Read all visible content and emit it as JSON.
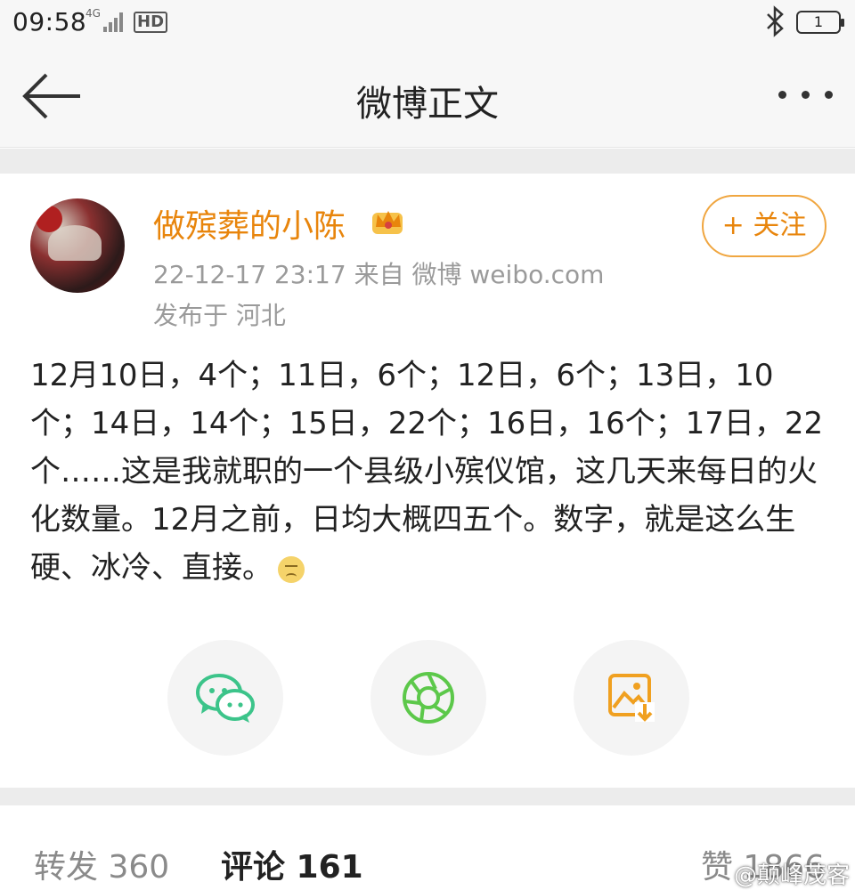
{
  "status_bar": {
    "time": "09:58",
    "network": "4G",
    "hd_label": "HD",
    "battery": "1"
  },
  "nav": {
    "title": "微博正文",
    "back_icon": "arrow-left-icon",
    "more_icon": "more-dots-icon"
  },
  "post": {
    "username": "做殡葬的小陈",
    "badge_icon": "crown-icon",
    "meta": "22-12-17 23:17  来自 微博 weibo.com",
    "location": "发布于 河北",
    "follow_label": "+ 关注",
    "text": "12月10日，4个；11日，6个；12日，6个；13日，10个；14日，14个；15日，22个；16日，16个；17日，22个……这是我就职的一个县级小殡仪馆，这几天来每日的火化数量。12月之前，日均大概四五个。数字，就是这么生硬、冰冷、直接。",
    "emoji_icon": "sad-face-icon"
  },
  "share": {
    "items": [
      {
        "icon": "wechat-icon"
      },
      {
        "icon": "moments-icon"
      },
      {
        "icon": "save-image-icon"
      }
    ]
  },
  "tabs": {
    "repost": "转发 360",
    "comments": "评论 161",
    "likes": "赞 1866"
  },
  "watermark": "@颠峰茂客",
  "colors": {
    "accent": "#e8850c",
    "wechat_green": "#3cc48a",
    "moments_green": "#5cc84a",
    "save_orange": "#f0a020"
  }
}
